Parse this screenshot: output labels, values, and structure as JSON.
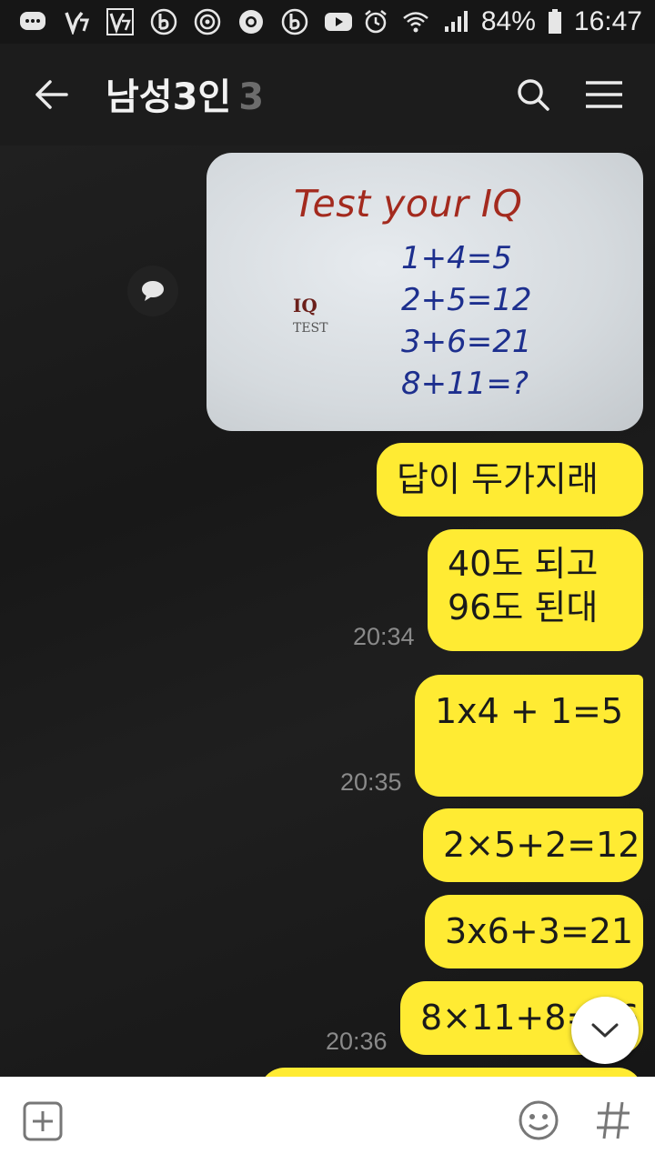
{
  "status_bar": {
    "battery": "84%",
    "time": "16:47",
    "icons_left": [
      "messenger-icon",
      "v3-icon",
      "v3-plus-icon",
      "b-app-icon",
      "target-icon",
      "chrome-icon",
      "b-app-icon",
      "youtube-icon"
    ],
    "icons_right": [
      "alarm-icon",
      "wifi-icon",
      "signal-icon",
      "battery-icon"
    ]
  },
  "header": {
    "title": "남성3인",
    "member_count": "3"
  },
  "photo": {
    "title": "Test your IQ",
    "equations": [
      "1+4=5",
      "2+5=12",
      "3+6=21",
      "8+11=?"
    ],
    "logo_iq": "IQ",
    "logo_test": "TEST"
  },
  "messages": [
    {
      "text": "답이 두가지래"
    },
    {
      "line1": "40도 되고",
      "line2": "96도 된대",
      "time": "20:34"
    },
    {
      "text": "1x4 + 1=5",
      "time": "20:35"
    },
    {
      "text": "2×5+2=12"
    },
    {
      "text": "3x6+3=21"
    },
    {
      "text": "8×11+8=96",
      "time": "20:36"
    }
  ],
  "colors": {
    "bubble": "#ffeb33",
    "background": "#1c1c1c",
    "time_text": "#8a8a8a"
  }
}
